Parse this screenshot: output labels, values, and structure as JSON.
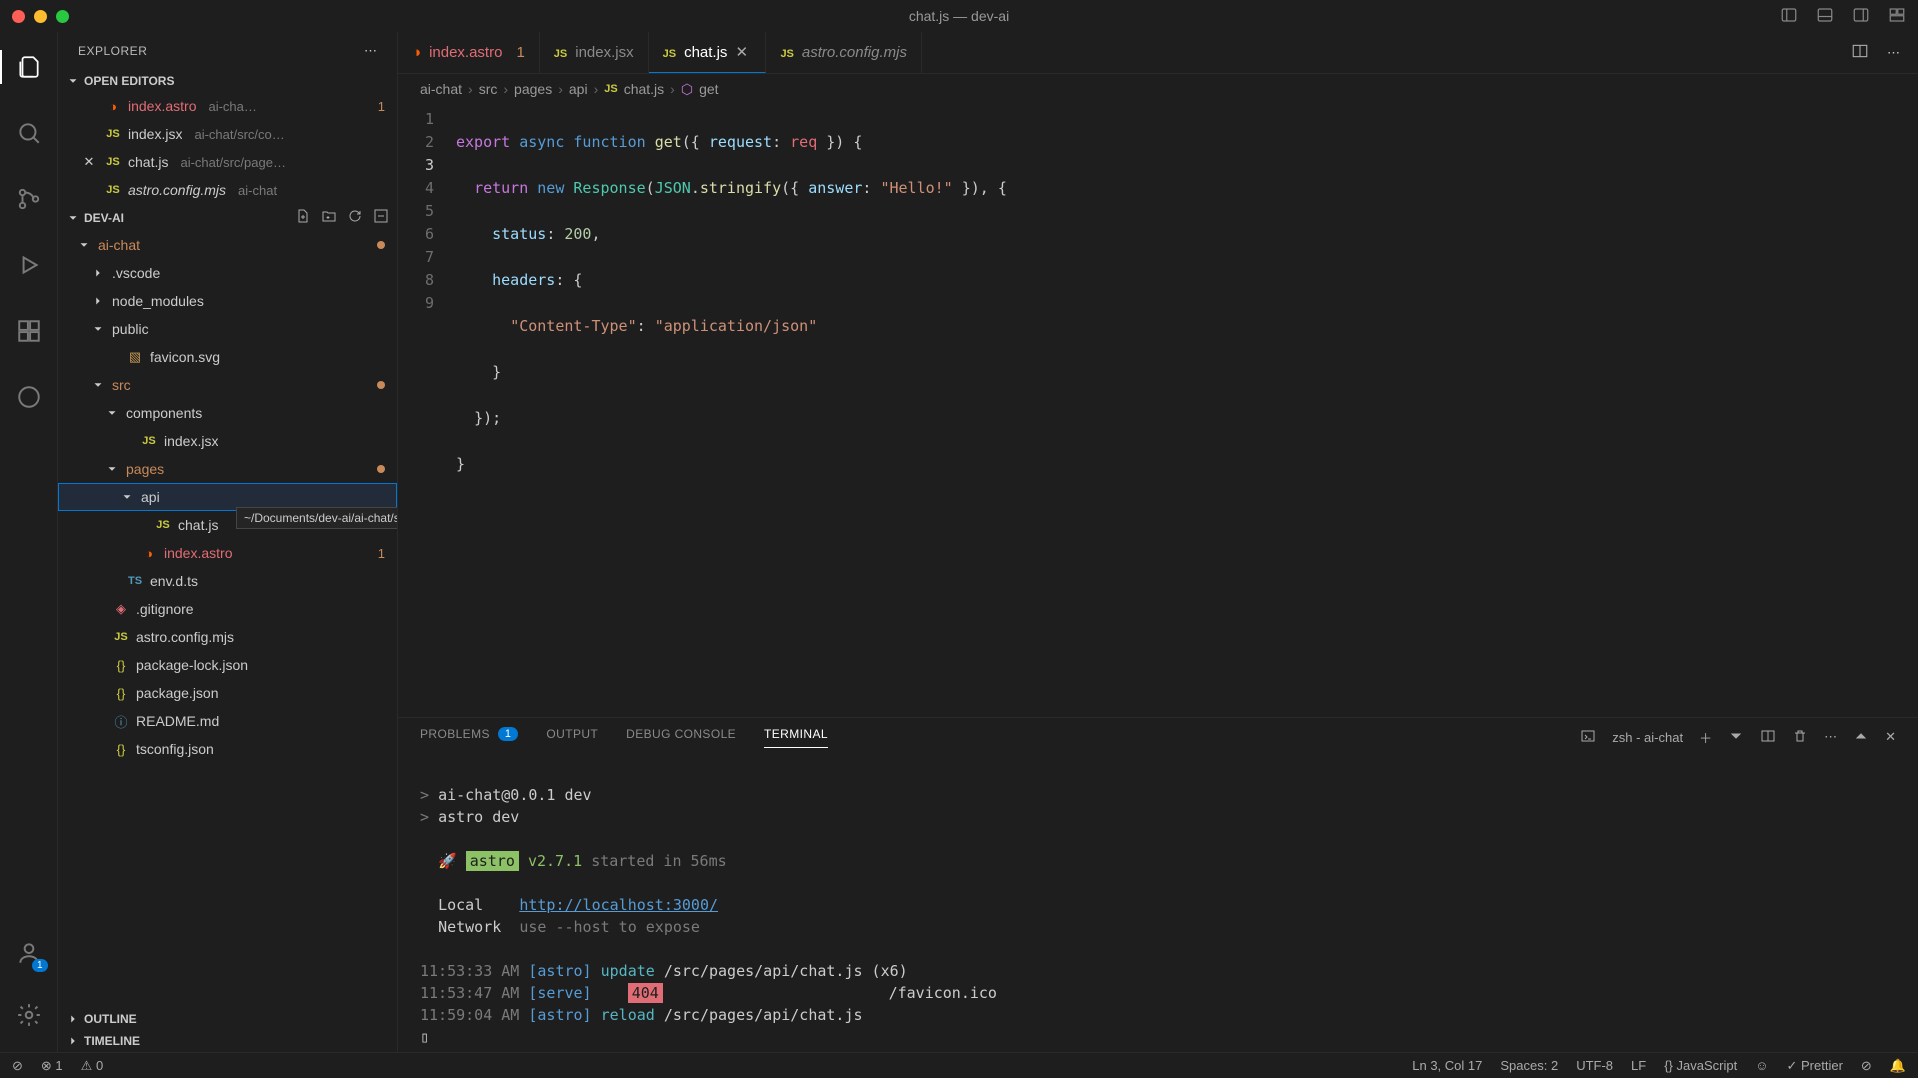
{
  "window": {
    "title": "chat.js — dev-ai"
  },
  "sidebar": {
    "title": "EXPLORER",
    "sections": {
      "open_editors": "OPEN EDITORS",
      "workspace": "DEV-AI",
      "outline": "OUTLINE",
      "timeline": "TIMELINE"
    }
  },
  "open_editors": [
    {
      "name": "index.astro",
      "detail": "ai-cha…",
      "counter": "1",
      "icon": "astro",
      "err": true
    },
    {
      "name": "index.jsx",
      "detail": "ai-chat/src/co…",
      "icon": "jsx"
    },
    {
      "name": "chat.js",
      "detail": "ai-chat/src/page…",
      "icon": "js",
      "close": true,
      "active": true
    },
    {
      "name": "astro.config.mjs",
      "detail": "ai-chat",
      "icon": "js",
      "italic": true
    }
  ],
  "file_tree": [
    {
      "indent": 0,
      "chev": "down",
      "label": "ai-chat",
      "folder": true,
      "dirty": true,
      "dot": true
    },
    {
      "indent": 1,
      "chev": "right",
      "label": ".vscode",
      "folder": true
    },
    {
      "indent": 1,
      "chev": "right",
      "label": "node_modules",
      "folder": true
    },
    {
      "indent": 1,
      "chev": "down",
      "label": "public",
      "folder": true
    },
    {
      "indent": 2,
      "label": "favicon.svg",
      "icon": "svg"
    },
    {
      "indent": 1,
      "chev": "down",
      "label": "src",
      "folder": true,
      "dirty": true,
      "dot": true
    },
    {
      "indent": 2,
      "chev": "down",
      "label": "components",
      "folder": true
    },
    {
      "indent": 3,
      "label": "index.jsx",
      "icon": "jsx"
    },
    {
      "indent": 2,
      "chev": "down",
      "label": "pages",
      "folder": true,
      "dirty": true,
      "dot": true
    },
    {
      "indent": 3,
      "chev": "down",
      "label": "api",
      "folder": true,
      "selected": true
    },
    {
      "indent": 4,
      "label": "chat.js",
      "icon": "js",
      "obscured": true
    },
    {
      "indent": 3,
      "label": "index.astro",
      "icon": "astro",
      "err": true,
      "counter": "1"
    },
    {
      "indent": 2,
      "label": "env.d.ts",
      "icon": "ts"
    },
    {
      "indent": 1,
      "label": ".gitignore",
      "icon": "git"
    },
    {
      "indent": 1,
      "label": "astro.config.mjs",
      "icon": "js"
    },
    {
      "indent": 1,
      "label": "package-lock.json",
      "icon": "json"
    },
    {
      "indent": 1,
      "label": "package.json",
      "icon": "json"
    },
    {
      "indent": 1,
      "label": "README.md",
      "icon": "md"
    },
    {
      "indent": 1,
      "label": "tsconfig.json",
      "icon": "json"
    }
  ],
  "tooltip": "/Documents/dev-ai/ai-chat/src/pages/api",
  "tabs": [
    {
      "label": "index.astro",
      "icon": "astro",
      "counter": "1",
      "err": true
    },
    {
      "label": "index.jsx",
      "icon": "jsx"
    },
    {
      "label": "chat.js",
      "icon": "js",
      "active": true,
      "close": true
    },
    {
      "label": "astro.config.mjs",
      "icon": "js",
      "italic": true
    }
  ],
  "breadcrumbs": [
    "ai-chat",
    "src",
    "pages",
    "api",
    "chat.js",
    "get"
  ],
  "code_lines": 9,
  "panel": {
    "tabs": {
      "problems": "PROBLEMS",
      "problems_count": "1",
      "output": "OUTPUT",
      "debug": "DEBUG CONSOLE",
      "terminal": "TERMINAL"
    },
    "terminal_session": "zsh - ai-chat"
  },
  "terminal_lines": {
    "l1_prompt": ">",
    "l1_text": "ai-chat@0.0.1 dev",
    "l2_prompt": ">",
    "l2_text": "astro dev",
    "astro_label": "astro",
    "astro_ver": "v2.7.1",
    "astro_started": "started in 56ms",
    "local_lbl": "Local",
    "local_url": "http://localhost:3000/",
    "network_lbl": "Network",
    "network_hint": "use --host to expose",
    "log1_time": "11:53:33 AM",
    "log1_src": "[astro]",
    "log1_act": "update",
    "log1_path": "/src/pages/api/chat.js (x6)",
    "log2_time": "11:53:47 AM",
    "log2_src": "[serve]",
    "log2_code": "404",
    "log2_path": "/favicon.ico",
    "log3_time": "11:59:04 AM",
    "log3_src": "[astro]",
    "log3_act": "reload",
    "log3_path": "/src/pages/api/chat.js"
  },
  "statusbar": {
    "errors": "1",
    "warnings": "0",
    "line_col": "Ln 3, Col 17",
    "spaces": "Spaces: 2",
    "encoding": "UTF-8",
    "eol": "LF",
    "language": "JavaScript",
    "prettier": "Prettier"
  }
}
